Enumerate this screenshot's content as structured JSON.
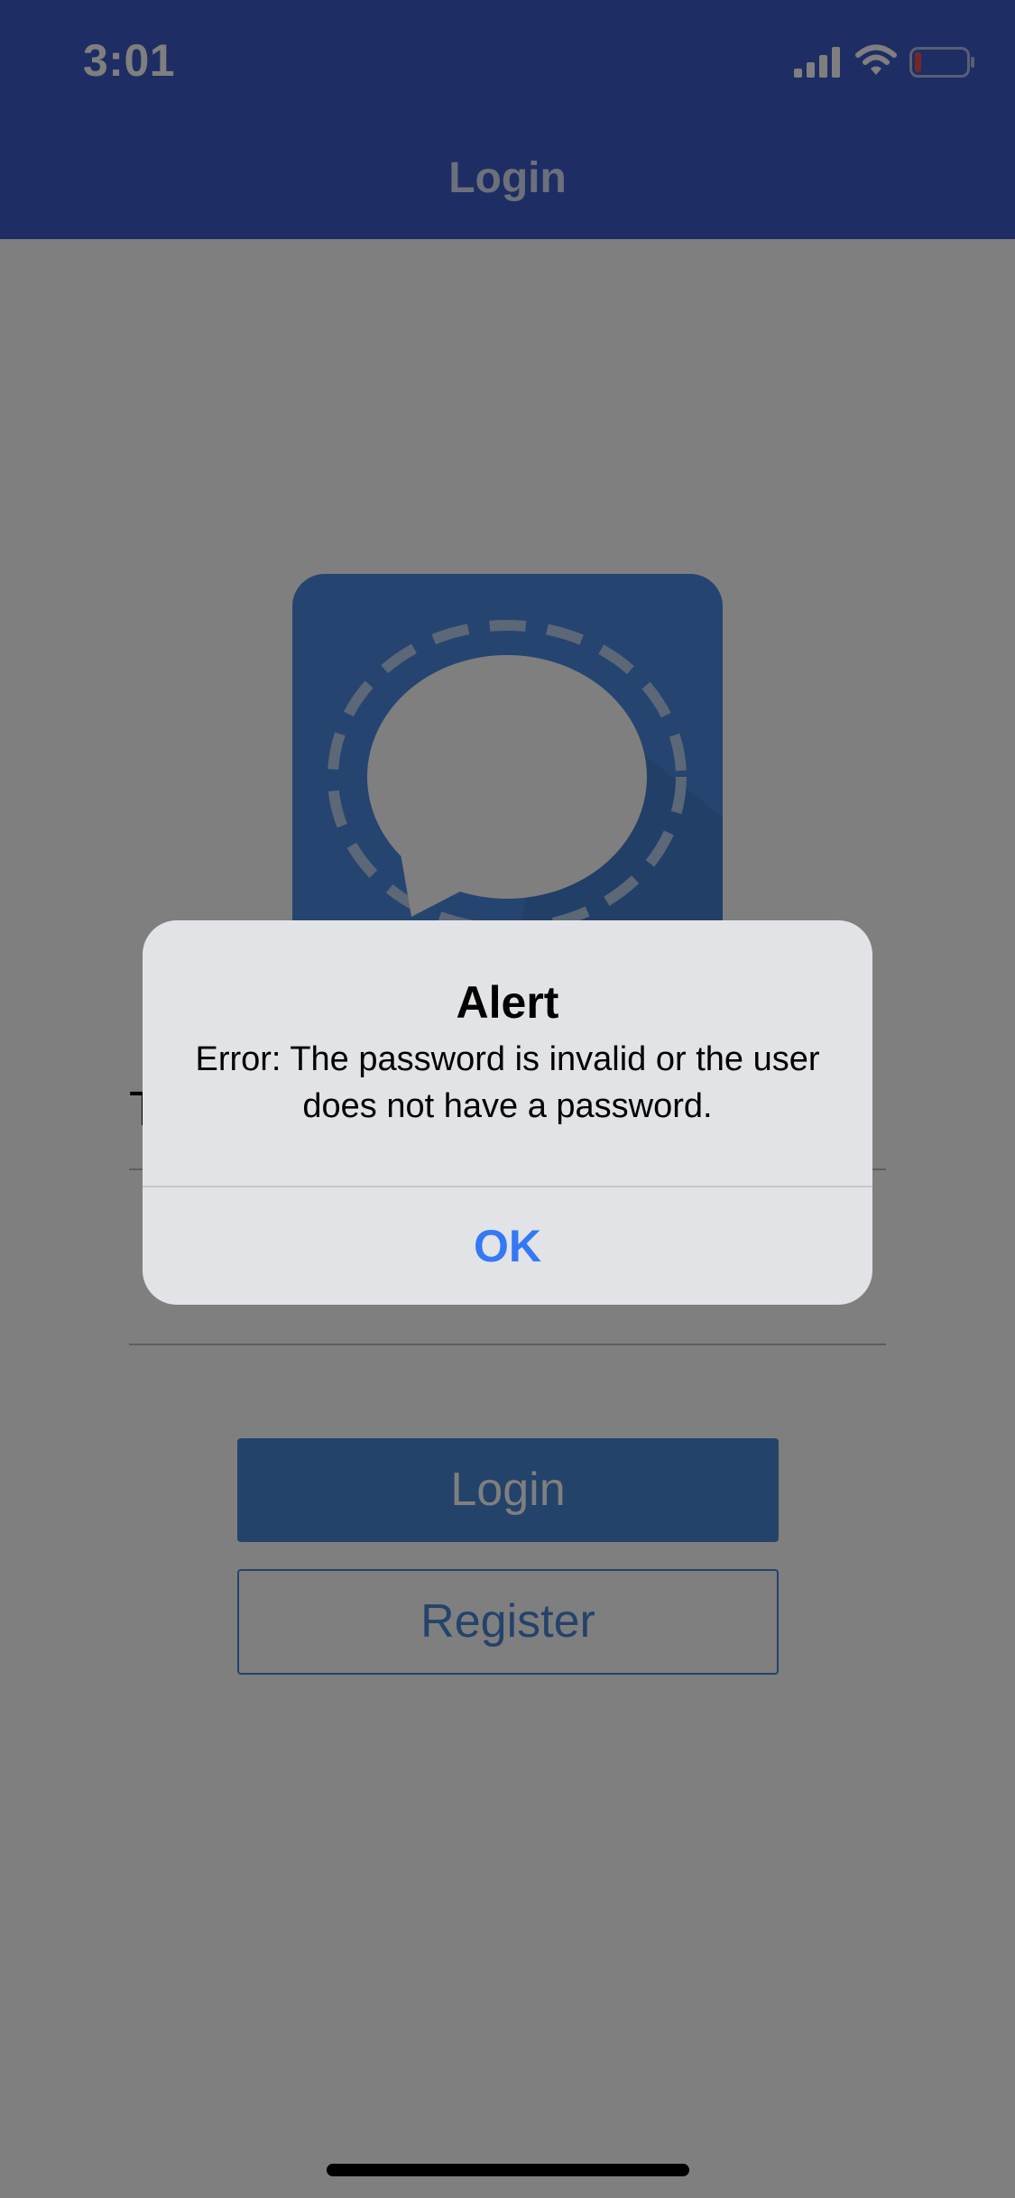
{
  "status_bar": {
    "time": "3:01",
    "icons": [
      "signal-icon",
      "wifi-icon",
      "battery-icon"
    ],
    "battery_level": 0.12
  },
  "nav": {
    "title": "Login"
  },
  "form": {
    "field_partial_text": "T",
    "login_label": "Login",
    "register_label": "Register"
  },
  "alert": {
    "title": "Alert",
    "message": "Error: The password is invalid or the user does not have a password.",
    "ok_label": "OK"
  },
  "colors": {
    "header": "#3c5dc8",
    "primary": "#4886d6",
    "alert_button": "#3478f6",
    "battery_low": "#e5534b"
  }
}
